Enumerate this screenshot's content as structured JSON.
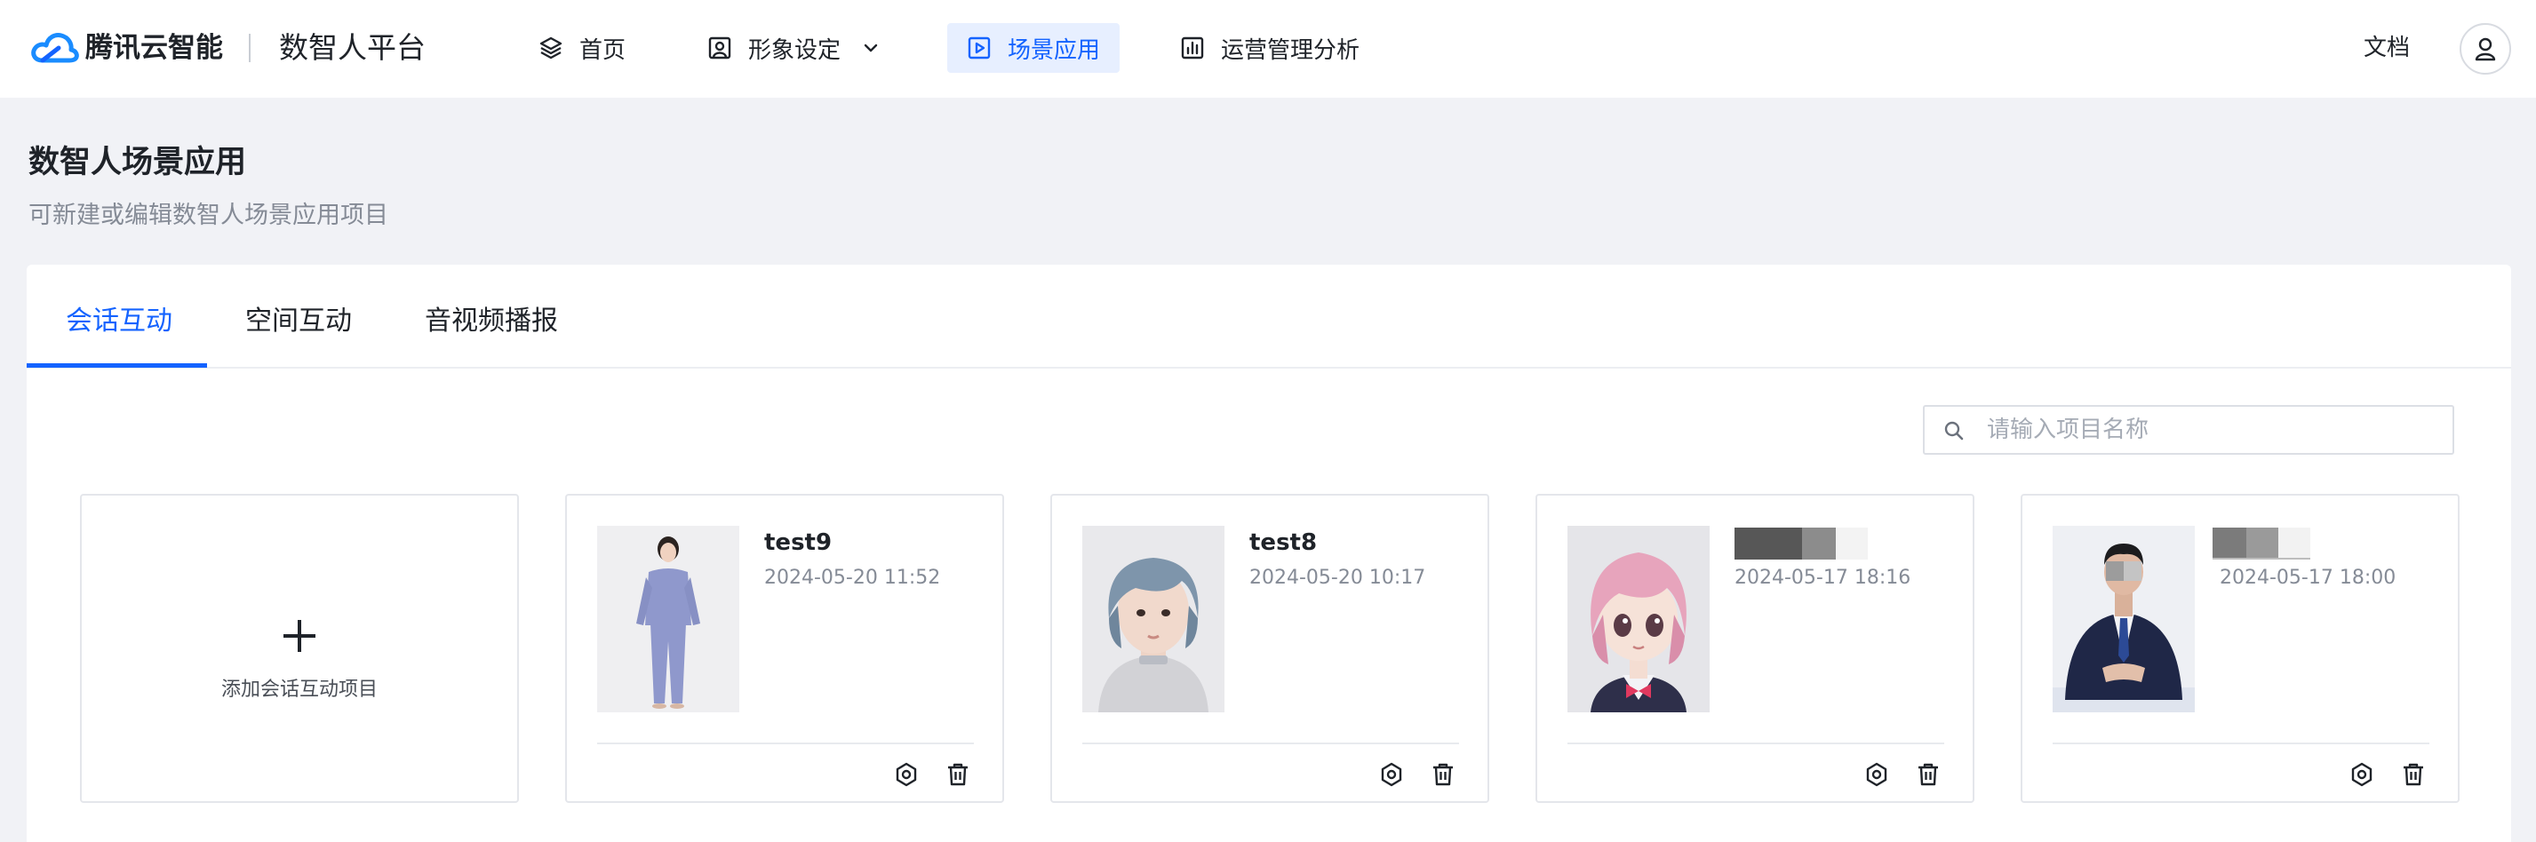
{
  "header": {
    "brand": "腾讯云智能",
    "platform": "数智人平台",
    "nav": [
      {
        "label": "首页",
        "icon": "layers-icon"
      },
      {
        "label": "形象设定",
        "icon": "portrait-icon"
      },
      {
        "label": "场景应用",
        "icon": "play-square-icon"
      },
      {
        "label": "运营管理分析",
        "icon": "bar-chart-icon"
      }
    ],
    "active_nav": "场景应用",
    "docs": "文档"
  },
  "page": {
    "title": "数智人场景应用",
    "subtitle": "可新建或编辑数智人场景应用项目"
  },
  "tabs": [
    {
      "label": "会话互动"
    },
    {
      "label": "空间互动"
    },
    {
      "label": "音视频播报"
    }
  ],
  "active_tab": "会话互动",
  "search": {
    "placeholder": "请输入项目名称",
    "value": ""
  },
  "add_card": {
    "label": "添加会话互动项目"
  },
  "projects": [
    {
      "name": "test9",
      "time": "2024-05-20 11:52",
      "avatar": "business-woman-full-body"
    },
    {
      "name": "test8",
      "time": "2024-05-20 10:17",
      "avatar": "silver-hair-woman-portrait"
    },
    {
      "name": "",
      "time": "2024-05-17 18:16",
      "avatar": "cartoon-girl-pink-hair"
    },
    {
      "name": "",
      "time": "2024-05-17 18:00",
      "avatar": "suited-man-seated"
    }
  ],
  "colors": {
    "accent": "#1463ff",
    "accent_bg": "#e7efff",
    "page_bg": "#f1f2f6",
    "muted_text": "#858b96"
  }
}
